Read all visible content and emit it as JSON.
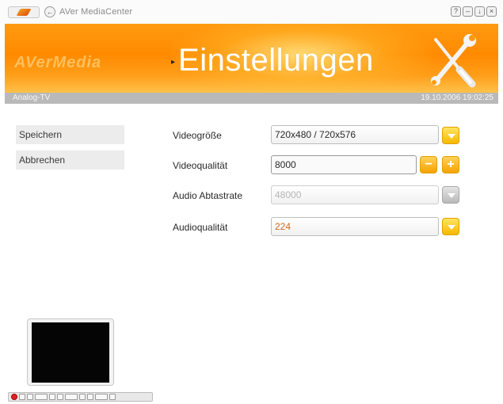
{
  "titlebar": {
    "app_title": "AVer MediaCenter",
    "back_symbol": "←",
    "buttons": [
      "?",
      "–",
      "↓",
      "×"
    ]
  },
  "header": {
    "brand": "AVerMedia",
    "page_title": "Einstellungen",
    "arrow": "▸",
    "icon": "tools-icon"
  },
  "strip": {
    "source": "Analog-TV",
    "datetime": "19.10.2006 19:02:25"
  },
  "menu": {
    "save_label": "Speichern",
    "cancel_label": "Abbrechen"
  },
  "settings": {
    "video_size": {
      "label": "Videogröße",
      "value": "720x480 / 720x576"
    },
    "video_quality": {
      "label": "Videoqualität",
      "value": "8000",
      "minus": "−",
      "plus": "+"
    },
    "audio_rate": {
      "label": "Audio Abtastrate",
      "value": "48000"
    },
    "audio_quality": {
      "label": "Audioqualität",
      "value": "224"
    }
  },
  "colors": {
    "header_orange": "#ff8a00",
    "button_yellow": "#f6b800",
    "strip_grey": "#b9b9b9"
  }
}
